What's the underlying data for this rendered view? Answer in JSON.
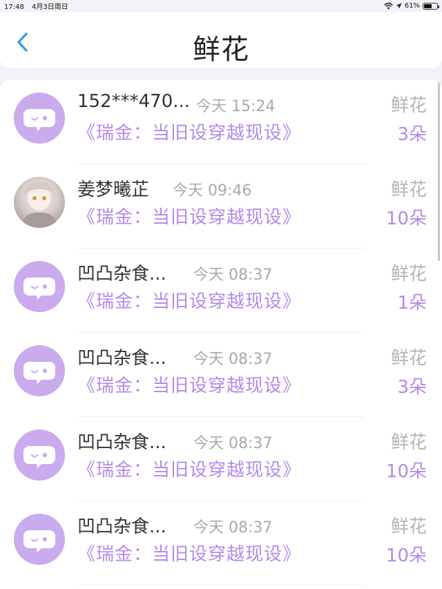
{
  "status": {
    "time": "17:48",
    "date": "4月3日周日",
    "battery": "61%",
    "battery_level": 0.61
  },
  "nav": {
    "title": "鲜花",
    "back_icon": "chevron-left-icon"
  },
  "colors": {
    "accent": "#b48ae8",
    "back": "#3a9bf0",
    "avatar_bg": "#c9abee"
  },
  "rows": [
    {
      "sender": "152***470...",
      "time": "今天 15:24",
      "gift": "鲜花",
      "book": "《瑞金：当旧设穿越现设》",
      "qty": "3朵",
      "avatar": "default"
    },
    {
      "sender": "姜梦曦芷",
      "time": "今天 09:46",
      "gift": "鲜花",
      "book": "《瑞金：当旧设穿越现设》",
      "qty": "10朵",
      "avatar": "photo"
    },
    {
      "sender": "凹凸杂食...",
      "time": "今天 08:37",
      "gift": "鲜花",
      "book": "《瑞金：当旧设穿越现设》",
      "qty": "1朵",
      "avatar": "default"
    },
    {
      "sender": "凹凸杂食...",
      "time": "今天 08:37",
      "gift": "鲜花",
      "book": "《瑞金：当旧设穿越现设》",
      "qty": "3朵",
      "avatar": "default"
    },
    {
      "sender": "凹凸杂食...",
      "time": "今天 08:37",
      "gift": "鲜花",
      "book": "《瑞金：当旧设穿越现设》",
      "qty": "10朵",
      "avatar": "default"
    },
    {
      "sender": "凹凸杂食...",
      "time": "今天 08:37",
      "gift": "鲜花",
      "book": "《瑞金：当旧设穿越现设》",
      "qty": "10朵",
      "avatar": "default"
    }
  ]
}
